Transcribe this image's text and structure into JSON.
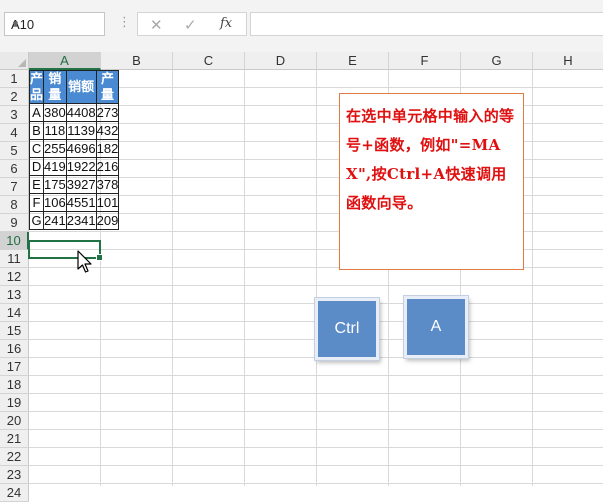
{
  "formula_bar": {
    "name_box": "A10",
    "fx_label": "fx",
    "cancel_glyph": "✕",
    "enter_glyph": "✓",
    "formula": ""
  },
  "sheet": {
    "columns": [
      "A",
      "B",
      "C",
      "D",
      "E",
      "F",
      "G",
      "H"
    ],
    "rows": [
      "1",
      "2",
      "3",
      "4",
      "5",
      "6",
      "7",
      "8",
      "9",
      "10",
      "11",
      "12",
      "13",
      "14",
      "15",
      "16",
      "17",
      "18",
      "19",
      "20",
      "21",
      "22",
      "23",
      "24"
    ],
    "active_cell": "A10"
  },
  "table": {
    "headers": [
      "产品",
      "销量",
      "销额",
      "产量"
    ],
    "header_color": "#4a8ad2",
    "rows": [
      [
        "A",
        "380",
        "4408",
        "273"
      ],
      [
        "B",
        "118",
        "1139",
        "432"
      ],
      [
        "C",
        "255",
        "4696",
        "182"
      ],
      [
        "D",
        "419",
        "1922",
        "216"
      ],
      [
        "E",
        "175",
        "3927",
        "378"
      ],
      [
        "F",
        "106",
        "4551",
        "101"
      ],
      [
        "G",
        "241",
        "2341",
        "209"
      ]
    ]
  },
  "callout": {
    "text": "在选中单元格中输入的等号+函数，例如\"=MAX\",按Ctrl+A快速调用函数向导。",
    "text_color": "#e01010",
    "border_color": "#e07a40"
  },
  "keys": {
    "ctrl": "Ctrl",
    "a": "A",
    "key_color": "#5b8cc8"
  },
  "icons": {
    "cursor": "mouse-pointer-icon",
    "dropdown": "chevron-down-icon"
  }
}
